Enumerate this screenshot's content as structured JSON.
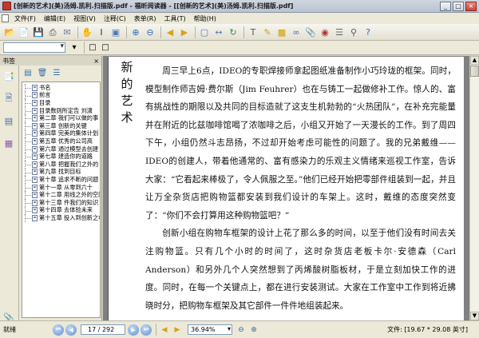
{
  "window": {
    "title": "[创新的艺术](美)汤姆.凯利.扫描版.pdf - 福昕阅读器 - [[创新的艺术](美)汤姆.凯利.扫描版.pdf]",
    "minimize": "_",
    "maximize": "□",
    "close": "×"
  },
  "menu": {
    "items": [
      "文件(F)",
      "编辑(E)",
      "视图(V)",
      "注释(C)",
      "表单(R)",
      "工具(T)",
      "帮助(H)"
    ]
  },
  "toolbar": {
    "icons": [
      "open-folder-icon",
      "open-file-icon",
      "save-icon",
      "print-icon",
      "email-icon",
      "hand-icon",
      "select-text-icon",
      "snapshot-icon",
      "zoom-in-icon",
      "zoom-out-icon",
      "back-icon",
      "forward-icon",
      "fit-page-icon",
      "fit-width-icon",
      "rotate-icon"
    ]
  },
  "sidebar": {
    "title": "书签",
    "close": "×",
    "bookmarks": [
      "书名",
      "前言",
      "目录",
      "目录数则所定告 刘潇",
      "第二章 我们可以做的事",
      "第三章 创新的关键",
      "第四章 完美的集体计划",
      "第五章 优秀的公司高",
      "第六章 通过模型去创建",
      "第七章 建造你的道路",
      "第八章 把握我们之外的",
      "第九章 找到目标",
      "第十章 追求不断的问题",
      "第十一章 从零到六十",
      "第十二章 用线之外的空间",
      "第十三章 件我们的知识",
      "第十四章 去体验未来",
      "第十五章 投入到创新之中"
    ]
  },
  "document": {
    "side_title": "新的艺术",
    "paragraphs": [
      "周三早上6点，IDEO的专职焊接师拿起图纸准备制作小巧玲珑的框架。同时，模型制作师吉姆·费尔斯（Jim Feuhrer）也在与铸工一起做修补工作。惊人的、富有挑战性的期限以及共同的目标造就了这支生机勃勃的“火热团队”，在补充完能量并在附近的比兹咖啡馆喝了浓咖啡之后，小组又开始了一天漫长的工作。到了周四下午，小组仍然斗志昂扬，不过却开始考虑可能性的问题了。我的兄弟戴维——IDEO的创建人，带着他通常的、富有感染力的乐观主义情绪来巡视工作室，告诉大家：“它看起来棒极了，令人佩服之至。”他们已经开始把零部件组装到一起，并且让万全杂货店把购物篮都安装到我们设计的车架上。这时，戴维的态度突然变了：“你们不会打算用这种购物篮吧？”",
      "创新小组在购物车框架的设计上花了那么多的时间，以至于他们没有时间去关注购物篮。只有几个小时的时间了，这时杂货店老板卡尔·安德森（Carl Anderson）和另外几个人突然想到了丙烯酸树脂板材，于是立刻加快工作的进度。同时，在每一个关键点上，都在进行安装测试。大家在工作室中工作到将近拂晓时分，把购物车框架及其它部件一件件地组装起来。"
    ]
  },
  "status": {
    "ready": "就绪",
    "page": "17 / 292",
    "zoom": "36.94%",
    "file_size": "文件: [19.67 * 29.08 英寸]"
  }
}
